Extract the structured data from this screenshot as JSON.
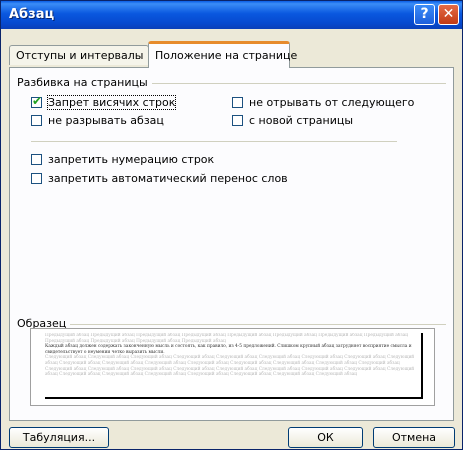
{
  "window": {
    "title": "Абзац"
  },
  "tabs": [
    {
      "label": "Отступы и интервалы"
    },
    {
      "label": "Положение на странице"
    }
  ],
  "pagination": {
    "group_label": "Разбивка на страницы",
    "widow_control": {
      "label": "Запрет висячих строк",
      "checked": true
    },
    "keep_lines": {
      "label": "не разрывать абзац",
      "checked": false
    },
    "keep_with_next": {
      "label": "не отрывать от следующего",
      "checked": false
    },
    "page_break_before": {
      "label": "с новой страницы",
      "checked": false
    }
  },
  "other": {
    "suppress_line_numbers": {
      "label": "запретить нумерацию строк",
      "checked": false
    },
    "no_hyphenation": {
      "label": "запретить автоматический перенос слов",
      "checked": false
    }
  },
  "preview": {
    "group_label": "Образец",
    "prev_text": "Предыдущий абзац Предыдущий абзац Предыдущий абзац Предыдущий абзац Предыдущий абзац Предыдущий абзац Предыдущий абзац Предыдущий абзац Предыдущий абзац Предыдущий абзац Предыдущий абзац Предыдущий абзац",
    "current_text": "Каждый абзац должен содержать законченную мысль и состоять, как правило, из 4-5 предложений. Слишком крупный абзац затрудняет восприятие смысла и свидетельствует о неумении четко выразить мысли.",
    "next_text": "Следующий абзац Следующий абзац Следующий абзац Следующий абзац Следующий абзац Следующий абзац Следующий абзац Следующий абзац Следующий абзац Следующий абзац Следующий абзац Следующий абзац Следующий абзац Следующий абзац Следующий абзац Следующий абзац Следующий абзац Следующий абзац Следующий абзац Следующий абзац Следующий абзац Следующий абзац Следующий абзац Следующий абзац Следующий абзац Следующий абзац Следующий абзац Следующий абзац Следующий абзац Следующий абзац Следующий абзац Следующий абзац Следующий абзац"
  },
  "buttons": {
    "tabs": "Табуляция...",
    "ok": "ОК",
    "cancel": "Отмена"
  },
  "colors": {
    "titlebar": "#0a58df",
    "close": "#c23a14",
    "tab_active_accent": "#e68b2c",
    "check": "#21a121"
  },
  "icons": {
    "help": "question-mark",
    "close": "x-mark",
    "check": "check-mark"
  }
}
